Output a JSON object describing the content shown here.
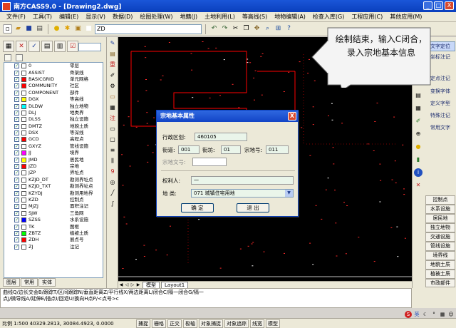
{
  "window": {
    "title": "南方CASS9.0 - [Drawing2.dwg]",
    "min_label": "_",
    "max_label": "□",
    "close_label": "X"
  },
  "menu": [
    "文件(F)",
    "工具(T)",
    "编辑(E)",
    "显示(V)",
    "数据(D)",
    "绘图处理(W)",
    "地籍(J)",
    "土地利用(L)",
    "等高线(S)",
    "地物编辑(A)",
    "检查入库(G)",
    "工程应用(C)",
    "其他应用(M)"
  ],
  "toolbar": {
    "layer_value": "ZD",
    "icons": [
      "new-icon",
      "open-icon",
      "save-icon",
      "print-icon",
      "undo-icon",
      "redo-icon",
      "pan-icon",
      "zoom-icon"
    ]
  },
  "left_panel": {
    "layers": [
      {
        "code": "0",
        "name": "零层",
        "color": "#ffffff"
      },
      {
        "code": "ASSIST",
        "name": "骨架线",
        "color": "#ffffff"
      },
      {
        "code": "BASICGRID",
        "name": "单元网格",
        "color": "#ff0000"
      },
      {
        "code": "COMMUNITY",
        "name": "社区",
        "color": "#ff0000"
      },
      {
        "code": "COMPONENT",
        "name": "部件",
        "color": "#ffffff"
      },
      {
        "code": "DGX",
        "name": "等高线",
        "color": "#ffff00"
      },
      {
        "code": "DLDW",
        "name": "独立地物",
        "color": "#00ffff"
      },
      {
        "code": "DLJ",
        "name": "地类界",
        "color": "#ffffff"
      },
      {
        "code": "DLSS",
        "name": "独立设施",
        "color": "#ffffff"
      },
      {
        "code": "DMTZ",
        "name": "地貌土质",
        "color": "#ffffff"
      },
      {
        "code": "DSX",
        "name": "等深线",
        "color": "#ffffff"
      },
      {
        "code": "GCD",
        "name": "高程点",
        "color": "#ff0000"
      },
      {
        "code": "GXYZ",
        "name": "管线设施",
        "color": "#ffffff"
      },
      {
        "code": "JJ",
        "name": "境界",
        "color": "#ff00ff"
      },
      {
        "code": "JMD",
        "name": "居民地",
        "color": "#ffff00"
      },
      {
        "code": "JZD",
        "name": "宗地",
        "color": "#ff0000"
      },
      {
        "code": "JZP",
        "name": "界址点",
        "color": "#ffffff"
      },
      {
        "code": "KZJD_DT",
        "name": "勘测界址点",
        "color": "#ffffff"
      },
      {
        "code": "KZJD_TXT",
        "name": "勘测界址点",
        "color": "#ffffff"
      },
      {
        "code": "KZYDJ",
        "name": "勘测用地界",
        "color": "#ffffff"
      },
      {
        "code": "KZD",
        "name": "控制点",
        "color": "#ffffff"
      },
      {
        "code": "MJZJ",
        "name": "面积注记",
        "color": "#ffffff"
      },
      {
        "code": "SJW",
        "name": "三角网",
        "color": "#ffffff"
      },
      {
        "code": "SZSS",
        "name": "水系设施",
        "color": "#0000ff"
      },
      {
        "code": "TK",
        "name": "图框",
        "color": "#ffffff"
      },
      {
        "code": "ZBTZ",
        "name": "植被土质",
        "color": "#00ff00"
      },
      {
        "code": "ZDH",
        "name": "展点号",
        "color": "#ff0000"
      },
      {
        "code": "ZJ",
        "name": "注记",
        "color": "#ffffff"
      }
    ],
    "tabs": [
      "图层",
      "常用",
      "实体"
    ]
  },
  "right_panel": {
    "top_items": [
      "文字定位",
      "坐标注记",
      "定点注记",
      "变换字体",
      "定义字型",
      "特殊注记",
      "常用文字"
    ],
    "buttons": [
      "控制点",
      "水系设施",
      "居民地",
      "独立地物",
      "交通设施",
      "管线设施",
      "境界线",
      "地貌土质",
      "植被土质",
      "市政部件"
    ]
  },
  "canvas": {
    "tabs": [
      "模型",
      "Layout1"
    ]
  },
  "dialog": {
    "title": "宗地基本属性",
    "district_label": "行政区划:",
    "district_value": "460105",
    "street_label": "街道:",
    "street_value": "001",
    "neighborhood_label": "街坊:",
    "neighborhood_value": "01",
    "parcel_label": "宗地号:",
    "parcel_value": "011",
    "parcel_text_label": "宗地文号:",
    "owner_label": "权利人:",
    "owner_value": "一",
    "landtype_label": "地  类:",
    "landtype_value": "071 城镇住宅用地",
    "ok_label": "确   定",
    "cancel_label": "退   出",
    "close_label": "X"
  },
  "callout": {
    "text": "绘制结束，输入C闭合，录入宗地基本信息"
  },
  "command": {
    "line1": "曲线Q/边长交会B/跟踪T/区间跟踪N/垂直距离Z/平行线X/两边距离L/闭合C/隔一闭合G/隔一",
    "line2": "点J/微导线A/延伸E/插点I/回退U/换向H点P/<点号>c"
  },
  "statusbar": {
    "coords": "比例 1:500  40329.2813, 30084.4923, 0.0000",
    "items": [
      "捕捉",
      "栅格",
      "正交",
      "极轴",
      "对象捕捉",
      "对象追踪",
      "线宽",
      "模型"
    ]
  },
  "colors": {
    "title_blue": "#0a3fbd",
    "canvas_bg": "#000000",
    "parcel_red": "#ff0000"
  }
}
